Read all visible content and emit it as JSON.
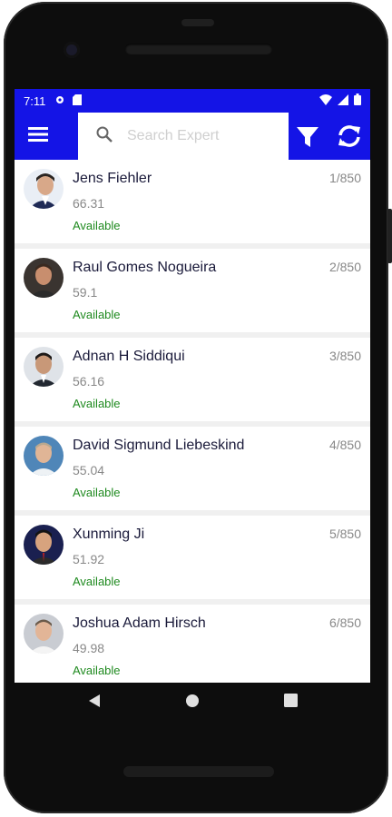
{
  "status_bar": {
    "time": "7:11"
  },
  "header": {
    "search": {
      "placeholder": "Search Expert",
      "value": ""
    }
  },
  "experts": [
    {
      "name": "Jens Fiehler",
      "score": "66.31",
      "status": "Available",
      "rank": "1/850"
    },
    {
      "name": "Raul Gomes Nogueira",
      "score": "59.1",
      "status": "Available",
      "rank": "2/850"
    },
    {
      "name": "Adnan H Siddiqui",
      "score": "56.16",
      "status": "Available",
      "rank": "3/850"
    },
    {
      "name": "David Sigmund Liebeskind",
      "score": "55.04",
      "status": "Available",
      "rank": "4/850"
    },
    {
      "name": "Xunming Ji",
      "score": "51.92",
      "status": "Available",
      "rank": "5/850"
    },
    {
      "name": "Joshua Adam Hirsch",
      "score": "49.98",
      "status": "Available",
      "rank": "6/850"
    }
  ],
  "colors": {
    "brand": "#1414e6",
    "available": "#1f8a1f"
  },
  "icons": [
    "menu-icon",
    "search-icon",
    "filter-icon",
    "refresh-icon",
    "back-icon",
    "home-icon",
    "recents-icon"
  ]
}
